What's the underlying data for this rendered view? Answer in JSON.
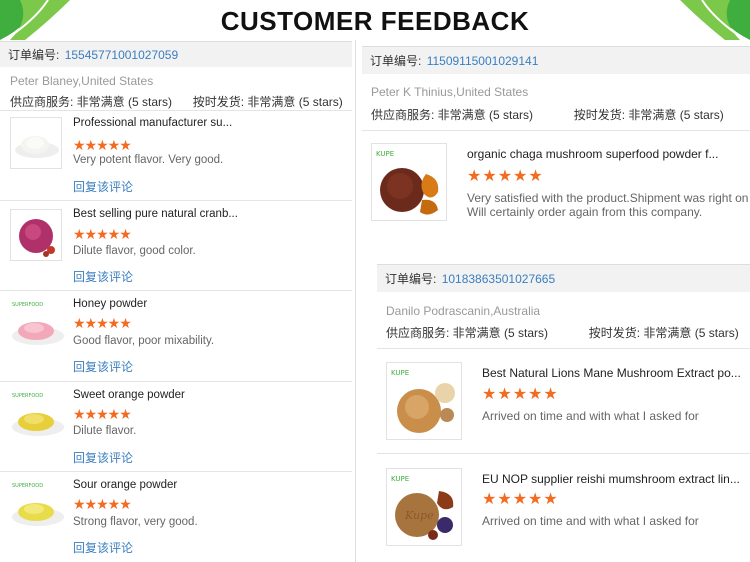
{
  "header": {
    "title": "CUSTOMER FEEDBACK"
  },
  "labels": {
    "order_no": "订单编号:",
    "supplier_service": "供应商服务: 非常满意",
    "shipping": "按时发货: 非常满意",
    "reply": "回复该评论"
  },
  "left": {
    "order_number": "15545771001027059",
    "customer": "Peter Blaney,United States",
    "service_rating": "(5 stars)",
    "shipping_rating": "(5 stars)",
    "items": [
      {
        "name": "Professional manufacturer su...",
        "stars": 5,
        "comment": "Very potent flavor. Very good."
      },
      {
        "name": "Best selling pure natural cranb...",
        "stars": 5,
        "comment": "Dilute flavor, good color."
      },
      {
        "name": "Honey powder",
        "stars": 5,
        "comment": "Good flavor, poor mixability."
      },
      {
        "name": "Sweet orange powder",
        "stars": 5,
        "comment": "Dilute flavor."
      },
      {
        "name": "Sour orange powder",
        "stars": 5,
        "comment": "Strong flavor, very good."
      }
    ]
  },
  "right_top": {
    "order_number": "11509115001029141",
    "customer": "Peter K Thinius,United States",
    "service_rating": "(5 stars)",
    "shipping_rating": "(5 stars)",
    "items": [
      {
        "name": "organic chaga mushroom superfood powder f...",
        "stars": 5,
        "comment_line1": "Very satisfied with the product.Shipment was right on t",
        "comment_line2": "Will certainly order again from this company."
      }
    ]
  },
  "right_bottom": {
    "order_number": "10183863501027665",
    "customer": "Danilo Podrascanin,Australia",
    "service_rating": "(5 stars)",
    "shipping_rating": "(5 stars)",
    "items": [
      {
        "name": "Best Natural Lions Mane Mushroom Extract po...",
        "stars": 5,
        "comment": "Arrived on time and with what I asked for"
      },
      {
        "name": "EU NOP supplier reishi mumshroom extract lin...",
        "stars": 5,
        "comment": "Arrived on time and with what I asked for"
      }
    ]
  },
  "star_glyphs": "★★★★★",
  "colors": {
    "link": "#3a7ebf",
    "stars": "#f26b21",
    "leaf_green": "#3fae3f"
  }
}
